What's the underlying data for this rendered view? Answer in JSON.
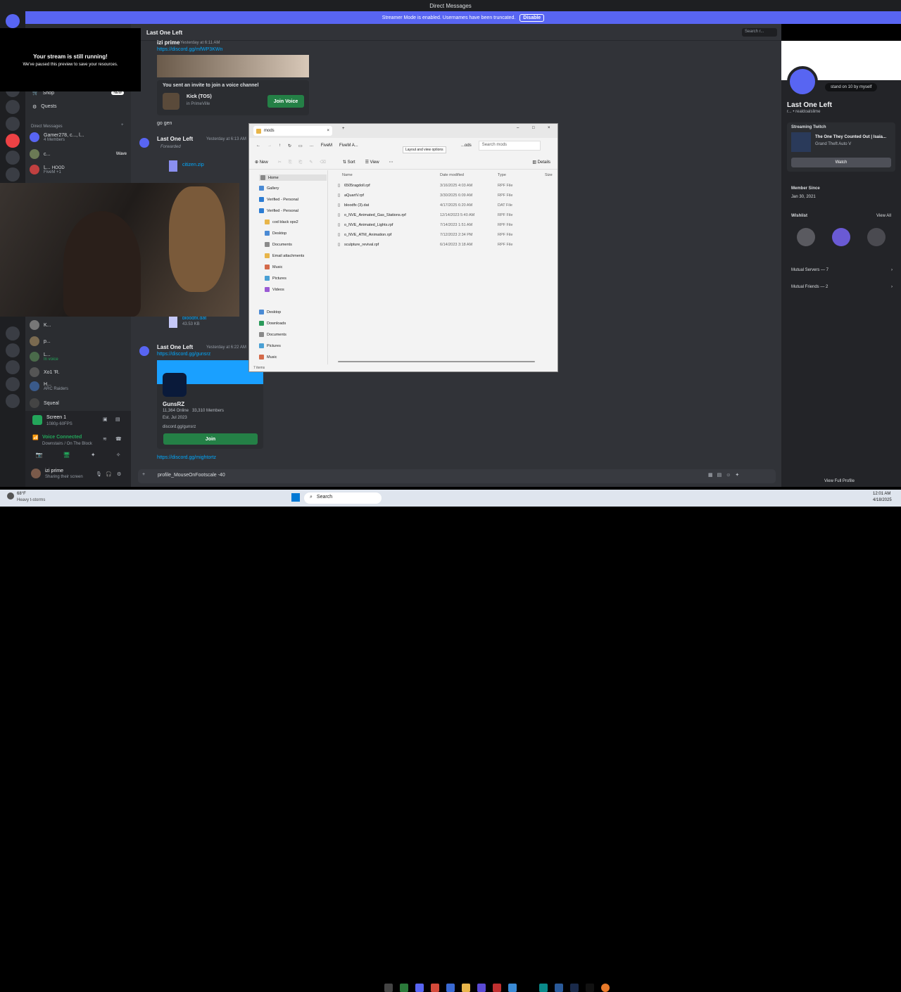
{
  "window": {
    "title": "Direct Messages"
  },
  "banner": {
    "text": "Streamer Mode is enabled. Usernames have been truncated.",
    "disable_label": "Disable"
  },
  "stream_overlay": {
    "title": "Your stream is still running!",
    "subtitle": "We've paused this preview to save your resources."
  },
  "channel_pane": {
    "shop_label": "Shop",
    "shop_badge": "NEW",
    "quests_label": "Quests",
    "dm_header": "Direct Messages",
    "dms": [
      {
        "name": "Gamer278, c..., l...",
        "sub": "4 Members"
      },
      {
        "name": "c...",
        "sub": "",
        "extra": "Wave"
      },
      {
        "name": "L...",
        "sub": "FiveM +1",
        "badge": "HOOD"
      },
      {
        "name": "K...",
        "sub": ""
      },
      {
        "name": "p...",
        "sub": ""
      },
      {
        "name": "L...",
        "sub": "In voice"
      },
      {
        "name": "Xo1 'R.",
        "sub": ""
      },
      {
        "name": "H...",
        "sub": "ARC Raiders"
      },
      {
        "name": "Squeal",
        "sub": ""
      }
    ],
    "screen_label": "Screen 1",
    "screen_sub": "1080p 60FPS",
    "voice_status": "Voice Connected",
    "voice_sub": "Downstairs / On The Block",
    "user_name": "izi prime",
    "user_status": "Sharing their screen"
  },
  "chat": {
    "channel_name": "Last One Left",
    "messages": [
      {
        "author": "izi prime",
        "time": "Yesterday at 6:11 AM",
        "link": "https://discord.gg/mfWP3KWn"
      },
      {
        "text": "go gen"
      },
      {
        "author": "Last One Left",
        "time": "Yesterday at 6:13 AM",
        "forwarded": "Forwarded",
        "file": "citizen.zip",
        "file2": "bloodfx.dat",
        "file2_size": "43.53 KB"
      },
      {
        "author": "Last One Left",
        "time": "Yesterday at 6:22 AM",
        "link": "https://discord.gg/gunsrz"
      },
      {
        "link2": "https://discord.gg/mightortz"
      }
    ],
    "voice_invite": {
      "title": "You sent an invite to join a voice channel",
      "server": "Kick",
      "channel": "(TOS)",
      "in": "in PrimeVille",
      "button": "Join Voice"
    },
    "invite": {
      "name": "GunsRZ",
      "online": "11,364 Online",
      "members": "33,310 Members",
      "est": "Est. Jul 2023",
      "url": "discord.gg/gunsrz",
      "button": "Join"
    },
    "composer_text": "profile_MouseOnFootscale -40"
  },
  "explorer": {
    "tab": "mods",
    "path": [
      "FiveM",
      "FiveM A...",
      "...ods"
    ],
    "tooltip": "Layout and view options",
    "search_placeholder": "Search mods",
    "toolbar": {
      "new": "New",
      "sort": "Sort",
      "view": "View",
      "details": "Details"
    },
    "columns": [
      "Name",
      "Date modified",
      "Type",
      "Size"
    ],
    "nav": [
      "Home",
      "Gallery",
      "Verified - Personal",
      "Verified - Personal",
      "cod black ops2",
      "Desktop",
      "Documents",
      "Email attachments",
      "Music",
      "Pictures",
      "Videos",
      "Desktop",
      "Downloads",
      "Documents",
      "Pictures",
      "Music"
    ],
    "files": [
      {
        "name": "6505ragdoll.rpf",
        "date": "3/16/2025 4:03 AM",
        "type": "RPF File"
      },
      {
        "name": "aQuartV.rpf",
        "date": "3/30/2025 6:09 AM",
        "type": "RPF File"
      },
      {
        "name": "bloodfx (3).dat",
        "date": "4/17/2025 6:20 AM",
        "type": "DAT File"
      },
      {
        "name": "o_NVE_Animated_Gas_Stations.rpf",
        "date": "12/14/2023 5:40 AM",
        "type": "RPF File"
      },
      {
        "name": "o_NVE_Animated_Lights.rpf",
        "date": "7/14/2023 1:51 AM",
        "type": "RPF File"
      },
      {
        "name": "o_NVE_ATM_Animation.rpf",
        "date": "7/12/2023 2:34 PM",
        "type": "RPF File"
      },
      {
        "name": "sculpture_revival.rpf",
        "date": "6/14/2023 3:18 AM",
        "type": "RPF File"
      }
    ],
    "status": "7 items"
  },
  "profile": {
    "status_bubble": "stand on 10 by myself",
    "name": "Last One Left",
    "handle": "r... • realdoalslime",
    "streaming_label": "Streaming Twitch",
    "stream_title": "The One They Counted Out | Isaia...",
    "stream_game": "Grand Theft Auto V",
    "watch": "Watch",
    "member_since_label": "Member Since",
    "member_since": "Jan 30, 2021",
    "wishlist": "Wishlist",
    "view_all": "View All",
    "mutual_servers": "Mutual Servers — 7",
    "mutual_friends": "Mutual Friends — 2",
    "view_full": "View Full Profile"
  },
  "header_search": "Search r...",
  "taskbar": {
    "weather_temp": "68°F",
    "weather_desc": "Heavy t-storms",
    "search": "Search",
    "time": "12:01 AM",
    "date": "4/18/2025"
  }
}
